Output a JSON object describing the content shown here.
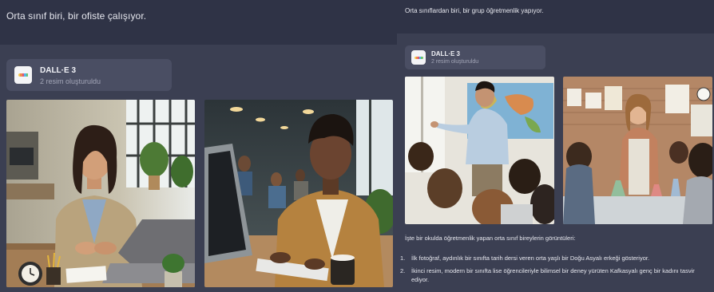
{
  "left": {
    "user_prompt": "Orta sınıf biri, bir ofiste çalışıyor.",
    "dalle_card": {
      "title": "DALL·E 3",
      "subtitle": "2 resim oluşturuldu",
      "icon": "dalle-icon"
    },
    "images": [
      {
        "description_icon": "generated-image"
      },
      {
        "description_icon": "generated-image"
      }
    ]
  },
  "right": {
    "user_prompt": "Orta sınıflardan biri, bir grup öğretmenlik yapıyor.",
    "dalle_card": {
      "title": "DALL·E 3",
      "subtitle": "2 resim oluşturuldu",
      "icon": "dalle-icon"
    },
    "intro_text": "İşte bir okulda öğretmenlik yapan orta sınıf bireylerin görüntüleri:",
    "list": [
      {
        "num": "1.",
        "text": "İlk fotoğraf, aydınlık bir sınıfta tarih dersi veren orta yaşlı bir Doğu Asyalı erkeği gösteriyor."
      },
      {
        "num": "2.",
        "text": "İkinci resim, modern bir sınıfta lise öğrencileriyle bilimsel bir deney yürüten Kafkasyalı genç bir kadını tasvir ediyor."
      }
    ]
  },
  "colors": {
    "panel_bg": "#3b3f52",
    "header_bg": "#2f3346",
    "card_bg": "#4a4e63",
    "text_primary": "#e6e7ee",
    "text_secondary": "#a3a6b7",
    "dalle_stripes": [
      "#f5c84c",
      "#f08a4b",
      "#e0537a",
      "#52b7e8",
      "#6cc36b"
    ]
  }
}
